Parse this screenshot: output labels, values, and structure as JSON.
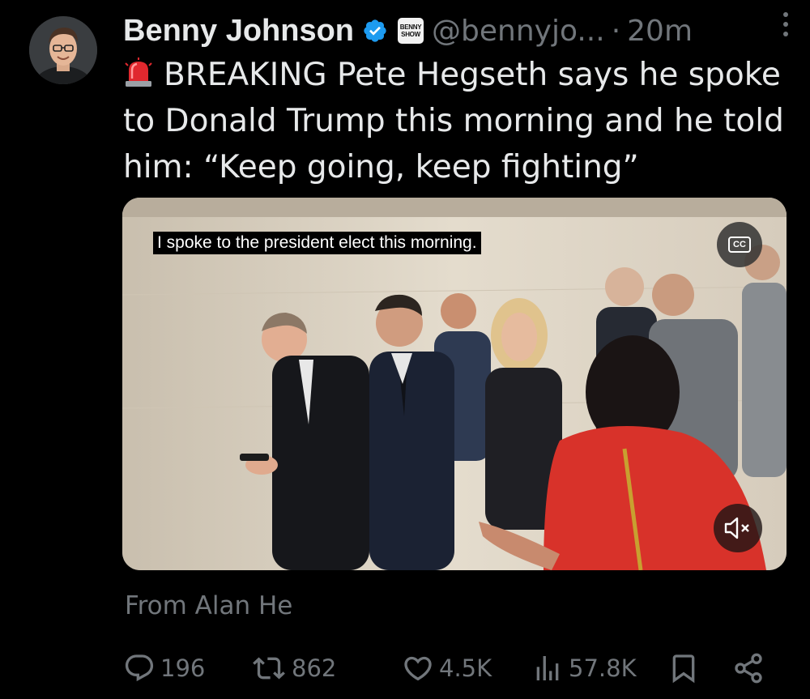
{
  "tweet": {
    "author": {
      "name": "Benny Johnson",
      "handle": "@bennyjo...",
      "verified": true,
      "affiliate_badge": "BENNY SHOW"
    },
    "time_separator": "·",
    "time": "20m",
    "more_icon": "ellipsis-vertical-icon",
    "text": "BREAKING Pete Hegseth says he spoke to Donald Trump this morning and he told him: “Keep going, keep fighting”",
    "text_prefix_icon": "police-siren-icon",
    "media": {
      "type": "video",
      "caption": "I spoke to the president elect this morning.",
      "cc_label": "CC",
      "muted": true
    },
    "source_label": "From Alan He",
    "stats": {
      "replies": "196",
      "reposts": "862",
      "likes": "4.5K",
      "views": "57.8K"
    }
  },
  "colors": {
    "background": "#000000",
    "text": "#e7e9ea",
    "muted": "#71767b",
    "verified": "#1d9bf0"
  }
}
